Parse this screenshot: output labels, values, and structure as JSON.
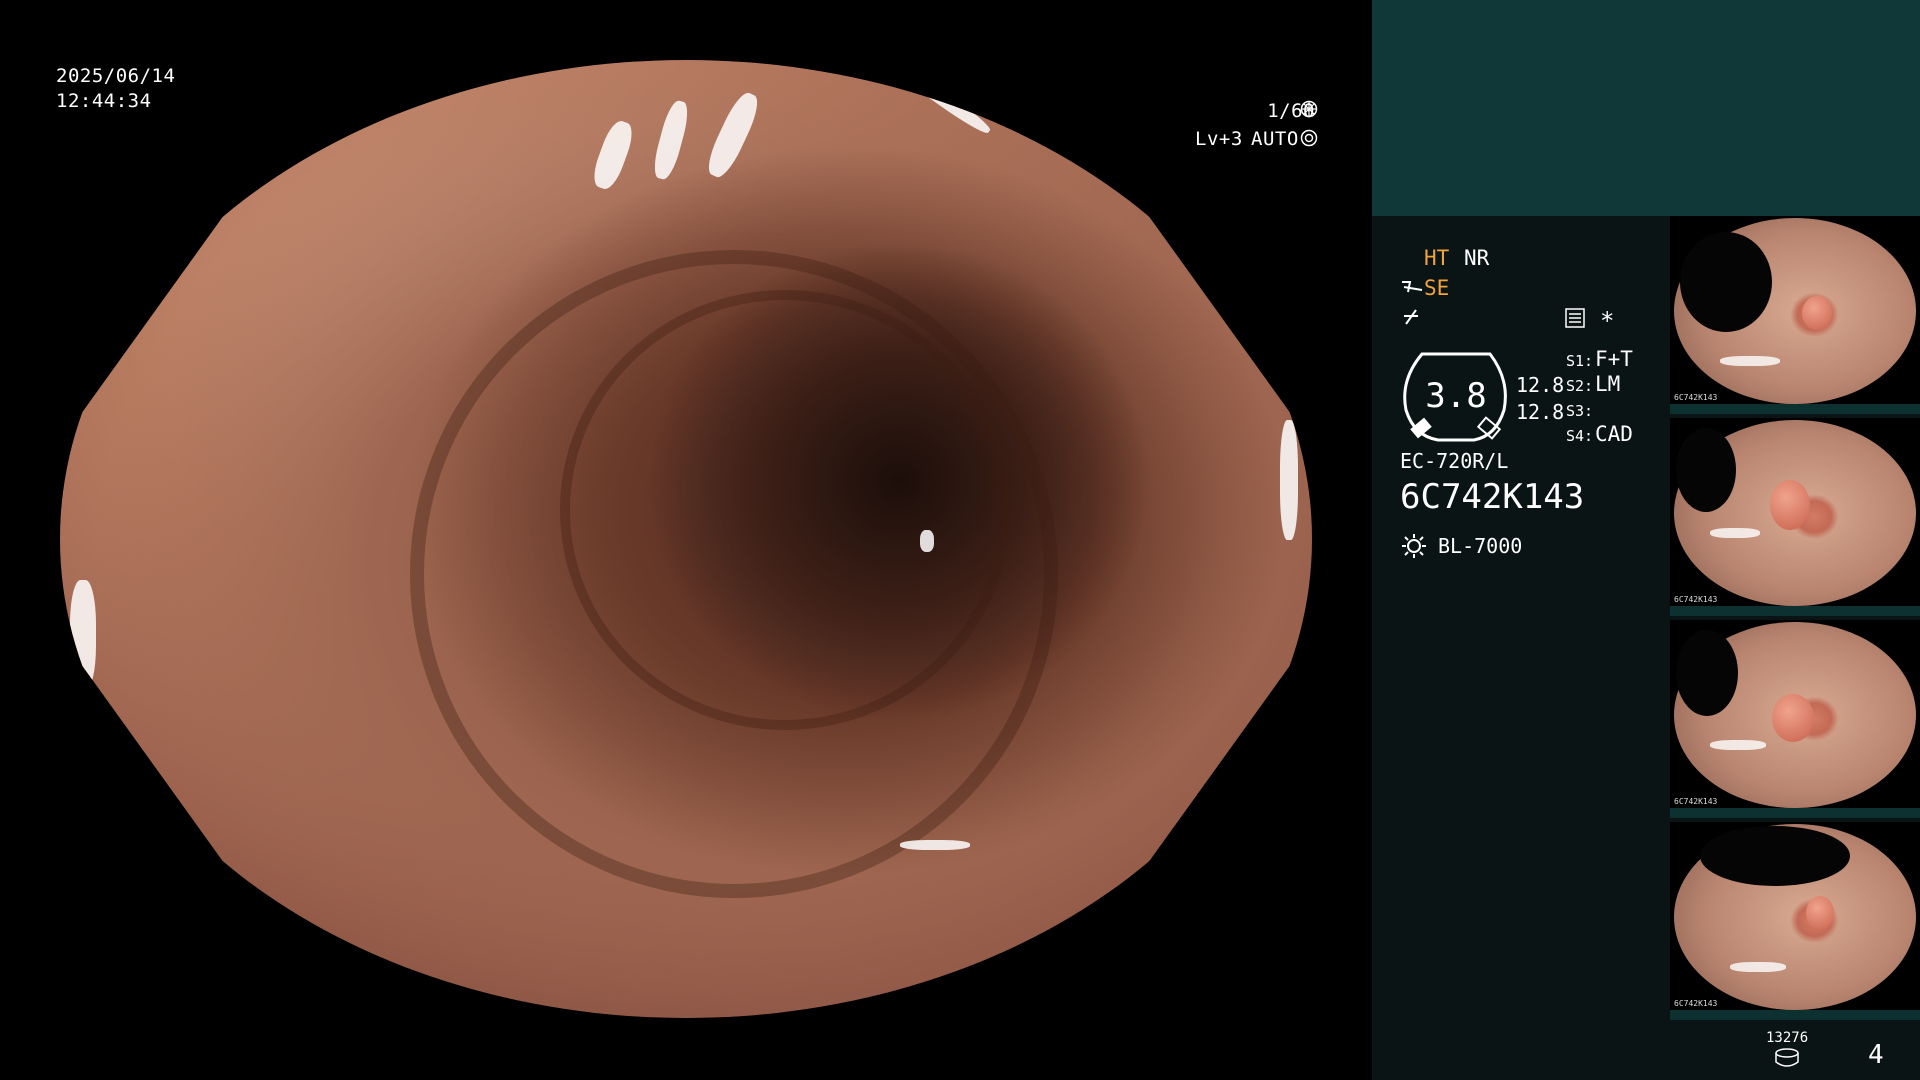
{
  "overlay": {
    "date": "2025/06/14",
    "time": "12:44:34",
    "shutter": "1/60",
    "level": "Lv+3",
    "mode": "AUTO"
  },
  "panel": {
    "ht": "HT",
    "nr": "NR",
    "se": "SE",
    "star": "*",
    "gauge_value": "3.8",
    "gauge_side_1": "12.8",
    "gauge_side_2": "12.8",
    "switches": [
      {
        "key": "S1:",
        "value": "F+T"
      },
      {
        "key": "S2:",
        "value": "LM"
      },
      {
        "key": "S3:",
        "value": ""
      },
      {
        "key": "S4:",
        "value": "CAD"
      }
    ],
    "scope_model": "EC-720R/L",
    "serial": "6C742K143",
    "light_source": "BL-7000",
    "storage_count": "13276",
    "image_count": "4"
  },
  "thumbnails": [
    {
      "label": "6C742K143"
    },
    {
      "label": "6C742K143"
    },
    {
      "label": "6C742K143"
    },
    {
      "label": "6C742K143"
    }
  ],
  "colors": {
    "accent_orange": "#f2a33a",
    "panel_bg": "#0a1414",
    "panel_header": "#103838"
  }
}
